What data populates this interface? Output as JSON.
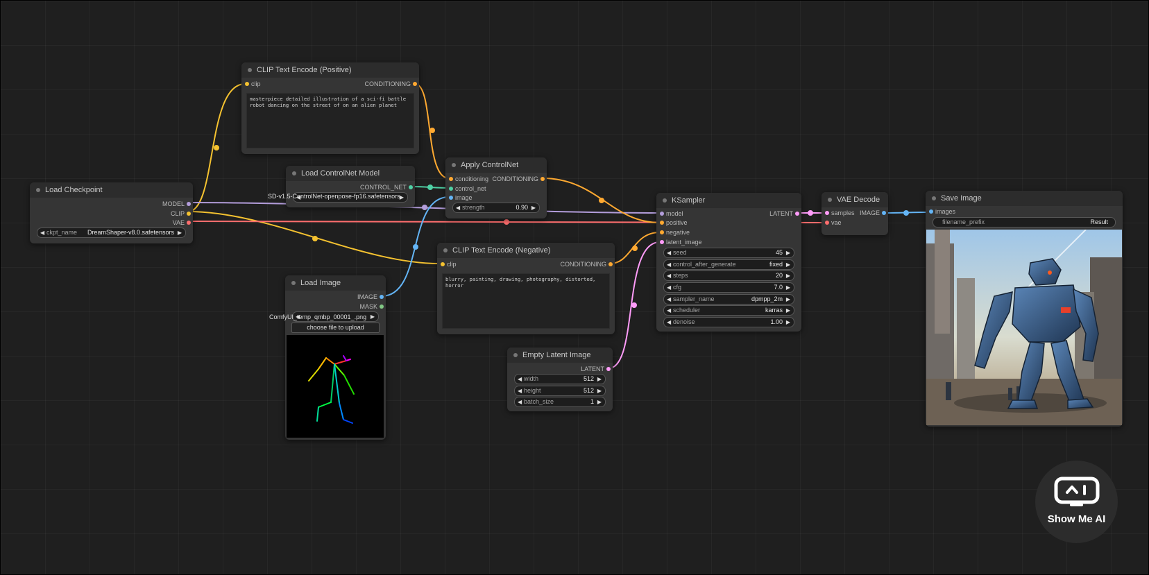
{
  "nodes": {
    "load_checkpoint": {
      "title": "Load Checkpoint",
      "outputs": {
        "model": "MODEL",
        "clip": "CLIP",
        "vae": "VAE"
      },
      "ckpt_name": {
        "name": "ckpt_name",
        "value": "DreamShaper-v8.0.safetensors"
      }
    },
    "clip_positive": {
      "title": "CLIP Text Encode (Positive)",
      "input": "clip",
      "output": "CONDITIONING",
      "text": "masterpiece detailed illustration of a sci-fi battle robot dancing on the street of on an alien planet"
    },
    "load_controlnet": {
      "title": "Load ControlNet Model",
      "output": "CONTROL_NET",
      "control_net_name": "SD-v1.5-ControlNet-openpose-fp16.safetensors"
    },
    "apply_controlnet": {
      "title": "Apply ControlNet",
      "inputs": {
        "conditioning": "conditioning",
        "control_net": "control_net",
        "image": "image"
      },
      "output": "CONDITIONING",
      "strength": {
        "name": "strength",
        "value": "0.90"
      }
    },
    "clip_negative": {
      "title": "CLIP Text Encode (Negative)",
      "input": "clip",
      "output": "CONDITIONING",
      "text": "blurry, painting, drawing, photography, distorted, horror"
    },
    "load_image": {
      "title": "Load Image",
      "outputs": {
        "image": "IMAGE",
        "mask": "MASK"
      },
      "image_name": "ComfyUI_temp_qmbp_00001_.png",
      "upload_label": "choose file to upload"
    },
    "empty_latent": {
      "title": "Empty Latent Image",
      "output": "LATENT",
      "width": {
        "name": "width",
        "value": "512"
      },
      "height": {
        "name": "height",
        "value": "512"
      },
      "batch_size": {
        "name": "batch_size",
        "value": "1"
      }
    },
    "ksampler": {
      "title": "KSampler",
      "inputs": {
        "model": "model",
        "positive": "positive",
        "negative": "negative",
        "latent_image": "latent_image"
      },
      "output": "LATENT",
      "seed": {
        "name": "seed",
        "value": "45"
      },
      "control_after_generate": {
        "name": "control_after_generate",
        "value": "fixed"
      },
      "steps": {
        "name": "steps",
        "value": "20"
      },
      "cfg": {
        "name": "cfg",
        "value": "7.0"
      },
      "sampler_name": {
        "name": "sampler_name",
        "value": "dpmpp_2m"
      },
      "scheduler": {
        "name": "scheduler",
        "value": "karras"
      },
      "denoise": {
        "name": "denoise",
        "value": "1.00"
      }
    },
    "vae_decode": {
      "title": "VAE Decode",
      "inputs": {
        "samples": "samples",
        "vae": "vae"
      },
      "output": "IMAGE"
    },
    "save_image": {
      "title": "Save Image",
      "input": "images",
      "filename_prefix": {
        "name": "filename_prefix",
        "value": "Result"
      }
    }
  },
  "logo": {
    "text": "Show Me AI"
  },
  "colors": {
    "clip": "#f5c230",
    "model": "#b39ddb",
    "vae": "#ff6e6e",
    "conditioning": "#ffa931",
    "control_net": "#4fd1a5",
    "image": "#64b5f6",
    "latent": "#ff9cf9",
    "mask": "#81c784"
  }
}
